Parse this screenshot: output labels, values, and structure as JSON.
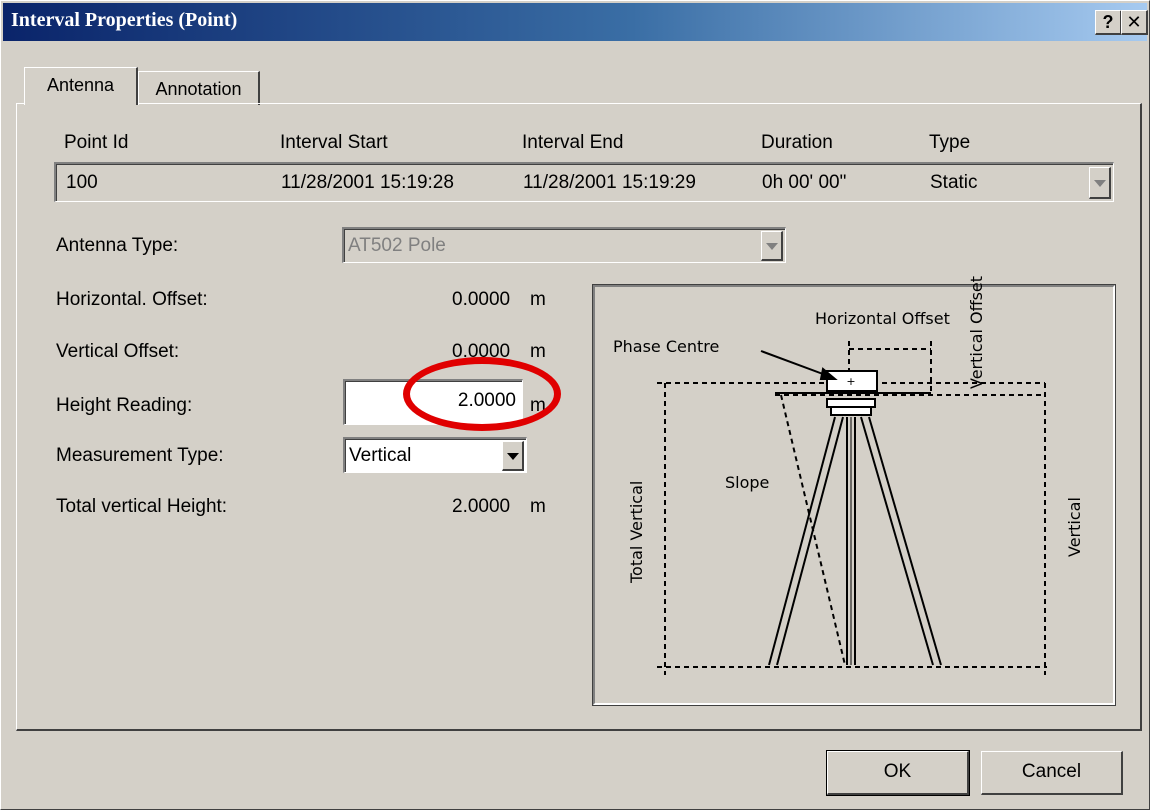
{
  "window": {
    "title": "Interval Properties (Point)",
    "help_button": "?",
    "close_button": "✕"
  },
  "tabs": [
    {
      "label": "Antenna",
      "active": true
    },
    {
      "label": "Annotation",
      "active": false
    }
  ],
  "interval": {
    "headers": [
      "Point Id",
      "Interval Start",
      "Interval End",
      "Duration",
      "Type"
    ],
    "row": [
      "100",
      "11/28/2001 15:19:28",
      "11/28/2001 15:19:29",
      "0h 00' 00\"",
      "Static"
    ]
  },
  "antenna": {
    "antenna_type_label": "Antenna Type:",
    "antenna_type_value": "AT502 Pole",
    "horizontal_offset_label": "Horizontal. Offset:",
    "horizontal_offset_value": "0.0000",
    "vertical_offset_label": "Vertical Offset:",
    "vertical_offset_value": "0.0000",
    "height_reading_label": "Height Reading:",
    "height_reading_value": "2.0000",
    "measurement_type_label": "Measurement Type:",
    "measurement_type_value": "Vertical",
    "total_vertical_label": "Total vertical Height:",
    "total_vertical_value": "2.0000",
    "unit": "m"
  },
  "diagram": {
    "horizontal_offset": "Horizontal Offset",
    "phase_centre": "Phase Centre",
    "vertical_offset": "Vertical Offset",
    "slope": "Slope",
    "total_vertical": "Total Vertical",
    "vertical": "Vertical"
  },
  "buttons": {
    "ok": "OK",
    "cancel": "Cancel"
  },
  "colors": {
    "title_start": "#0a246a",
    "title_end": "#a6caf0",
    "highlight": "#e00000",
    "face": "#d4d0c8"
  }
}
